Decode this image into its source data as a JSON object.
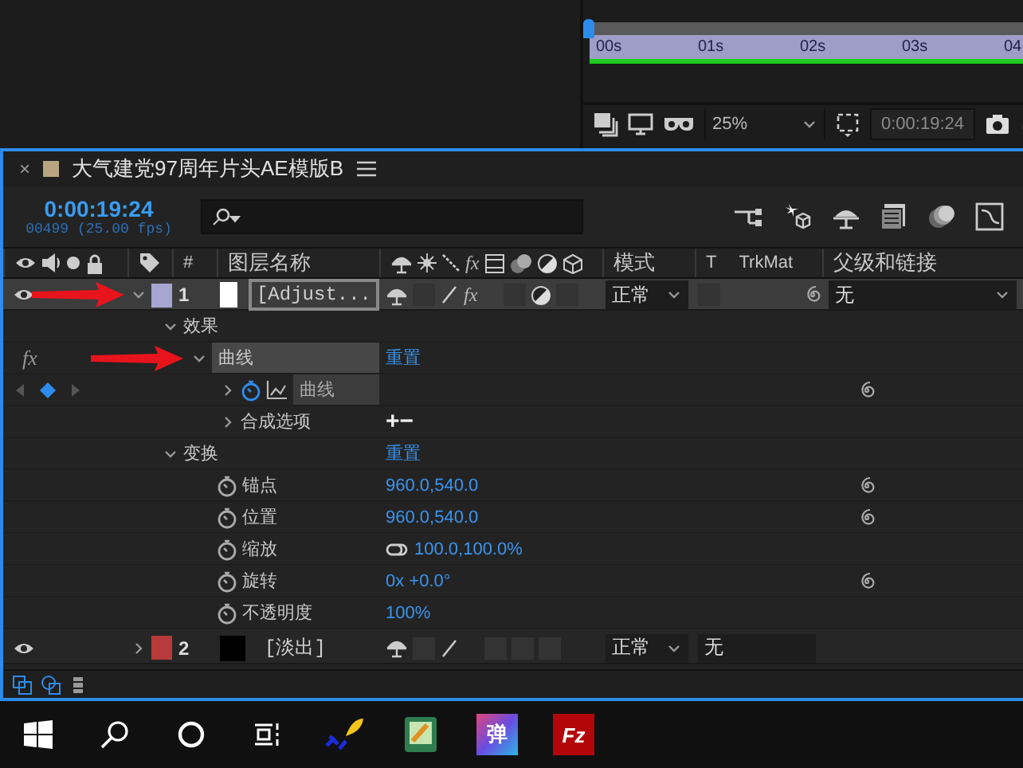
{
  "viewer": {
    "ruler_ticks": [
      "00s",
      "01s",
      "02s",
      "03s",
      "04"
    ],
    "zoom": "25%",
    "timecode": "0:00:19:24"
  },
  "comp": {
    "close": "×",
    "title": "大气建党97周年片头AE模版B",
    "timecode": "0:00:19:24",
    "frame_info": "00499 (25.00 fps)",
    "columns": {
      "number": "#",
      "name": "图层名称",
      "switch_fx": "fx",
      "mode": "模式",
      "t": "T",
      "trkmat": "TrkMat",
      "parent": "父级和链接"
    },
    "layers": [
      {
        "number": "1",
        "name": "[Adjust...",
        "color": "#a6a6d0",
        "selected": true,
        "expanded": true,
        "arrow": true,
        "switch_fx": "fx",
        "mode": "正常",
        "parent": "无",
        "properties": [
          {
            "kind": "group",
            "label": "效果",
            "expanded": true,
            "children": [
              {
                "kind": "effect",
                "label": "曲线",
                "badge": "fx",
                "expanded": true,
                "value": "重置",
                "arrow": true,
                "children": [
                  {
                    "kind": "curve",
                    "label": "曲线",
                    "expanded": false,
                    "animated": true,
                    "keyframe": true,
                    "pick_whip": true
                  },
                  {
                    "kind": "options",
                    "label": "合成选项",
                    "expanded": false,
                    "value": "+−"
                  }
                ]
              }
            ]
          },
          {
            "kind": "group",
            "label": "变换",
            "expanded": true,
            "value": "重置",
            "children": [
              {
                "kind": "property",
                "label": "锚点",
                "value": "960.0,540.0",
                "animated": false,
                "pick_whip": true
              },
              {
                "kind": "property",
                "label": "位置",
                "value": "960.0,540.0",
                "animated": false,
                "pick_whip": true
              },
              {
                "kind": "property",
                "label": "缩放",
                "value": "100.0,100.0%",
                "linked": true,
                "animated": false,
                "pick_whip": false
              },
              {
                "kind": "property",
                "label": "旋转",
                "value": "0x +0.0°",
                "animated": false,
                "pick_whip": true
              },
              {
                "kind": "property",
                "label": "不透明度",
                "value": "100%",
                "animated": false,
                "pick_whip": false
              }
            ]
          }
        ]
      },
      {
        "number": "2",
        "name": "[淡出]",
        "color": "#b83a3a",
        "selected": false,
        "expanded": false,
        "arrow": false,
        "mode": "正常",
        "trkmat": "无"
      }
    ]
  },
  "taskbar": {
    "apps": [
      {
        "kind": "start"
      },
      {
        "kind": "search"
      },
      {
        "kind": "cortana"
      },
      {
        "kind": "task-view"
      },
      {
        "kind": "feather"
      },
      {
        "kind": "notebook"
      },
      {
        "kind": "danmaku",
        "label": "弹"
      },
      {
        "kind": "filezilla",
        "label": "Fz"
      }
    ]
  }
}
